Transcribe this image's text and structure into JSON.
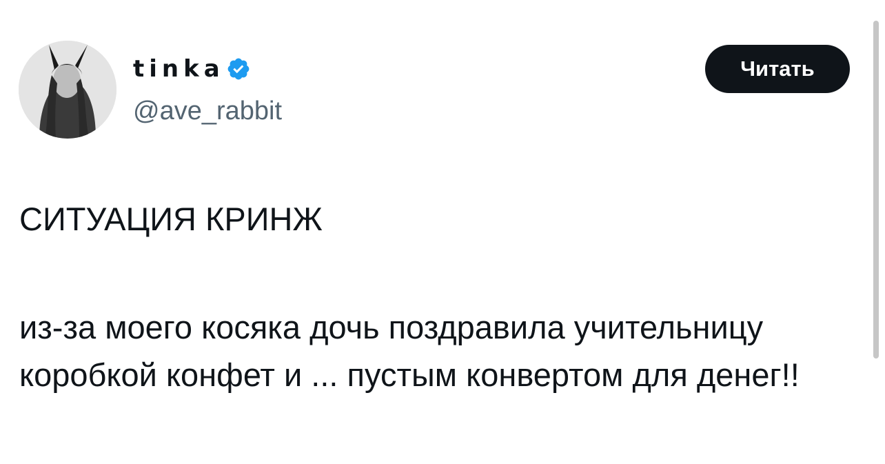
{
  "author": {
    "display_name": "tinka",
    "handle": "@ave_rabbit",
    "verified": true,
    "verified_icon": "verified-badge-icon",
    "verified_color": "#1d9bf0"
  },
  "follow_button": {
    "label": "Читать"
  },
  "tweet": {
    "headline": "СИТУАЦИЯ КРИНЖ",
    "body": "из-за моего косяка дочь поздравила учительницу коробкой конфет и ... пустым конвертом для денег!!"
  },
  "colors": {
    "text": "#0f1419",
    "secondary_text": "#536471",
    "button_bg": "#0f1419",
    "button_text": "#ffffff"
  }
}
